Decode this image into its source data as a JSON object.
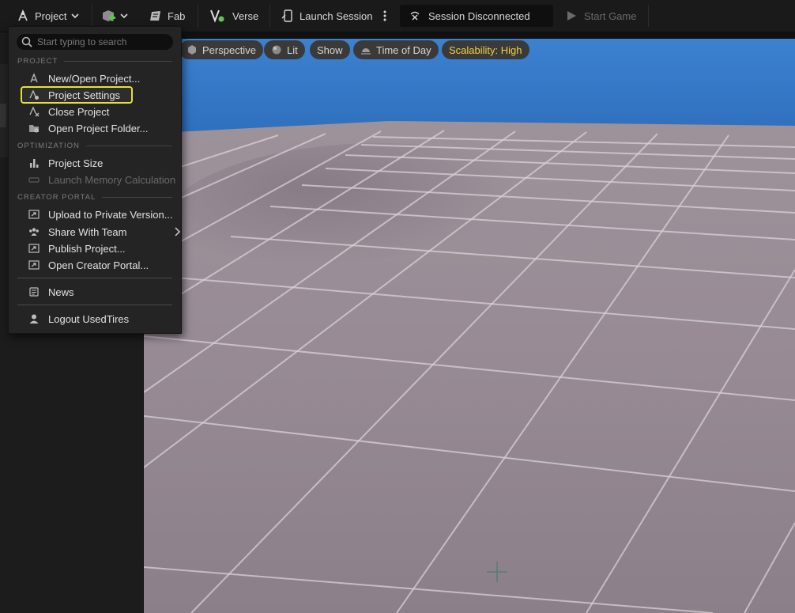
{
  "toolbar": {
    "project_label": "Project",
    "fab_label": "Fab",
    "verse_label": "Verse",
    "launch_session_label": "Launch Session",
    "session_status": "Session Disconnected",
    "start_game_label": "Start Game"
  },
  "viewport_toolbar": {
    "perspective": "Perspective",
    "lit": "Lit",
    "show": "Show",
    "time_of_day": "Time of Day",
    "scalability": "Scalability: High"
  },
  "menu": {
    "search_placeholder": "Start typing to search",
    "sections": {
      "project": "PROJECT",
      "optimization": "OPTIMIZATION",
      "creator_portal": "CREATOR PORTAL"
    },
    "items": {
      "new_open_project": "New/Open Project...",
      "project_settings": "Project Settings",
      "close_project": "Close Project",
      "open_project_folder": "Open Project Folder...",
      "project_size": "Project Size",
      "launch_memory_calc": "Launch Memory Calculation",
      "upload_private_version": "Upload to Private Version...",
      "share_with_team": "Share With Team",
      "publish_project": "Publish Project...",
      "open_creator_portal": "Open Creator Portal...",
      "news": "News",
      "logout": "Logout UsedTires"
    }
  },
  "colors": {
    "highlight_border": "#e8e035",
    "scalability_text": "#f3d03e",
    "sky": "#3a7bc8",
    "ground": "#928895"
  }
}
